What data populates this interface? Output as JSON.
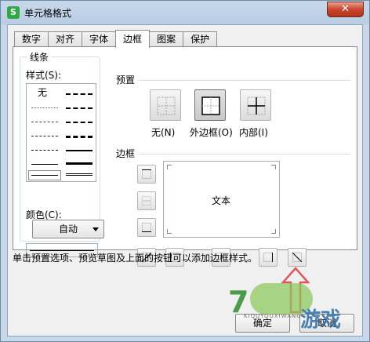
{
  "window": {
    "title": "单元格格式",
    "app_icon": "S"
  },
  "tabs": [
    "数字",
    "对齐",
    "字体",
    "边框",
    "图案",
    "保护"
  ],
  "active_tab": "边框",
  "line_group": {
    "title": "线条",
    "style_label": "样式(S):",
    "none_label": "无",
    "color_label": "颜色(C):",
    "color_value": "自动"
  },
  "preset_group": {
    "title": "预置",
    "buttons": [
      {
        "label": "无(N)"
      },
      {
        "label": "外边框(O)"
      },
      {
        "label": "内部(I)"
      }
    ]
  },
  "border_group": {
    "title": "边框",
    "preview_text": "文本"
  },
  "hint": "单击预置选项、预览草图及上面的按钮可以添加边框样式。",
  "buttons": {
    "ok": "确定",
    "cancel": "取消"
  },
  "watermark": {
    "text_main": "游戏",
    "text_sub": "KIQUYOUXIWANG"
  },
  "colors": {
    "accent_arrow": "#e0565b",
    "close_button": "#c8452c"
  }
}
